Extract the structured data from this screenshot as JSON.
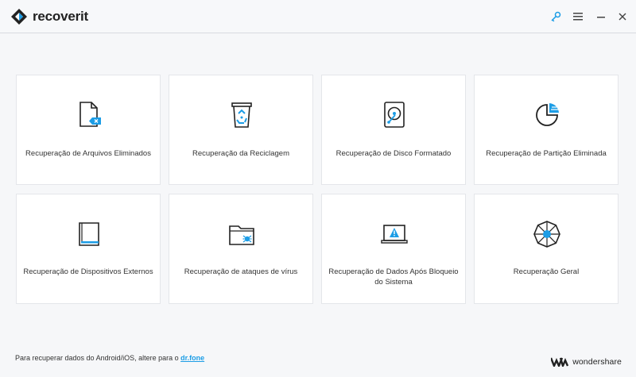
{
  "app": {
    "name": "recoverit"
  },
  "window_controls": {
    "key_icon": "key-icon",
    "menu_icon": "hamburger-menu-icon",
    "minimize_icon": "minimize-icon",
    "close_icon": "close-icon"
  },
  "cards": [
    {
      "label": "Recuperação de Arquivos Eliminados",
      "icon": "deleted-file-icon"
    },
    {
      "label": "Recuperação da Reciclagem",
      "icon": "recycle-bin-icon"
    },
    {
      "label": "Recuperação de Disco Formatado",
      "icon": "formatted-disk-icon"
    },
    {
      "label": "Recuperação de Partição Eliminada",
      "icon": "partition-icon"
    },
    {
      "label": "Recuperação de Dispositivos Externos",
      "icon": "external-device-icon"
    },
    {
      "label": "Recuperação de ataques de vírus",
      "icon": "virus-folder-icon"
    },
    {
      "label": "Recuperação de Dados Após Bloqueio do Sistema",
      "icon": "crashed-system-icon"
    },
    {
      "label": "Recuperação Geral",
      "icon": "all-around-recovery-icon"
    }
  ],
  "footer": {
    "text": "Para recuperar dados do Android/iOS, altere para o ",
    "link": "dr.fone"
  },
  "brand": {
    "name": "wondershare"
  },
  "colors": {
    "accent": "#1c9de6",
    "icon_stroke": "#222222",
    "background": "#f6f7f9"
  }
}
